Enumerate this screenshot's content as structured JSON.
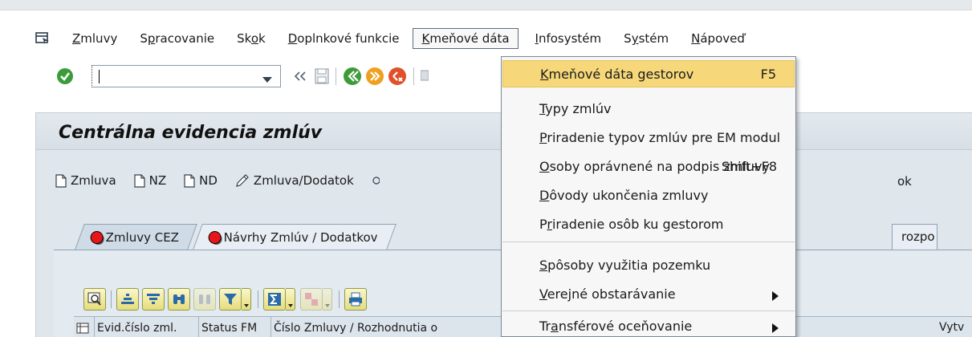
{
  "menubar": {
    "items": [
      {
        "pre": "",
        "u": "Z",
        "post": "mluvy"
      },
      {
        "pre": "S",
        "u": "p",
        "post": "racovanie"
      },
      {
        "pre": "Sk",
        "u": "o",
        "post": "k"
      },
      {
        "pre": "",
        "u": "D",
        "post": "oplnkové funkcie"
      },
      {
        "pre": "",
        "u": "K",
        "post": "meňové dáta"
      },
      {
        "pre": "",
        "u": "I",
        "post": "nfosystém"
      },
      {
        "pre": "S",
        "u": "y",
        "post": "stém"
      },
      {
        "pre": "",
        "u": "N",
        "post": "ápoveď"
      }
    ]
  },
  "toolbar": {
    "command_value": ""
  },
  "screen": {
    "title": "Centrálna evidencia zmlúv",
    "app_buttons": {
      "zmluva": "Zmluva",
      "nz": "NZ",
      "nd": "ND",
      "zmluva_dodatok": "Zmluva/Dodatok"
    },
    "right_partial_text": "ok",
    "tabs": {
      "tab1": "Zmluvy CEZ",
      "tab2": "Návrhy Zmlúv / Dodatkov",
      "right_partial": "rozpo"
    },
    "grid_columns": [
      "Evid.číslo zml.",
      "Status FM",
      "Číslo Zmluvy / Rozhodnutia o",
      "Vytv"
    ]
  },
  "dropdown": {
    "items": [
      {
        "pre": "",
        "u": "K",
        "post": "meňové dáta gestorov",
        "shortcut": "F5"
      },
      {
        "pre": "",
        "u": "T",
        "post": "ypy zmlúv",
        "shortcut": ""
      },
      {
        "pre": "",
        "u": "P",
        "post": "riradenie typov zmlúv pre EM modul",
        "shortcut": ""
      },
      {
        "pre": "",
        "u": "O",
        "post": "soby oprávnené na podpis zmluvy",
        "shortcut": "Shift+F8"
      },
      {
        "pre": "",
        "u": "D",
        "post": "ôvody ukončenia zmluvy",
        "shortcut": ""
      },
      {
        "pre": "P",
        "u": "r",
        "post": "iradenie osôb ku gestorom",
        "shortcut": ""
      },
      {
        "pre": "",
        "u": "S",
        "post": "pôsoby využitia pozemku",
        "shortcut": ""
      },
      {
        "pre": "",
        "u": "V",
        "post": "erejné obstarávanie",
        "shortcut": ""
      },
      {
        "pre": "Tr",
        "u": "a",
        "post": "nsférové oceňovanie",
        "shortcut": ""
      }
    ]
  },
  "colors": {
    "highlight": "#f6d87a",
    "screen_bg": "#dfe6ec",
    "status_red": "#e8161b",
    "ok_green": "#3c9c3c"
  }
}
